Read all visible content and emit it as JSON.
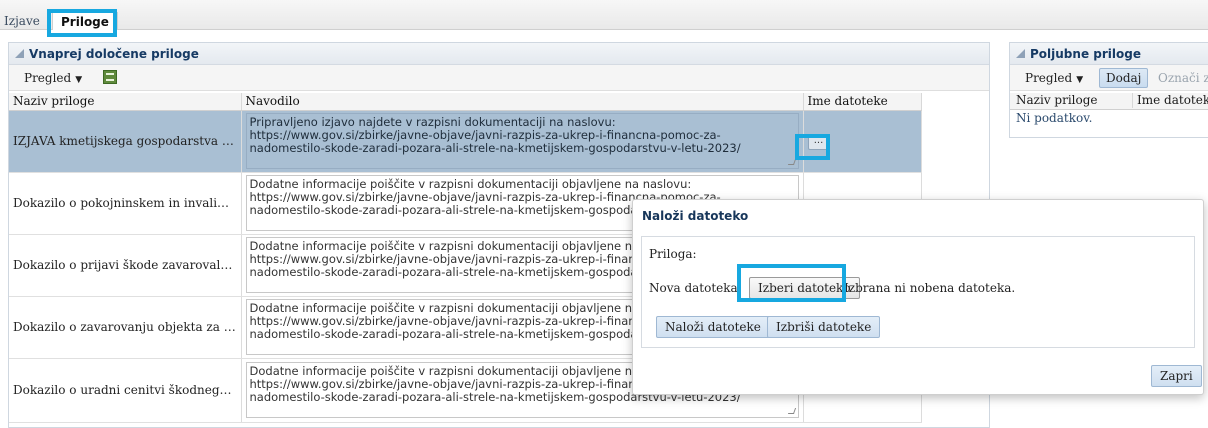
{
  "tabs": {
    "inactive_label": "Izjave",
    "active_label": "Priloge"
  },
  "left_panel": {
    "title": "Vnaprej določene priloge",
    "toolbar": {
      "view_label": "Pregled"
    },
    "columns": [
      "Naziv priloge",
      "Navodilo",
      "Ime datoteke"
    ],
    "rows": [
      {
        "name": "IZJAVA kmetijskega gospodarstva gled...",
        "instructions": [
          "Pripravljeno izjavo najdete v razpisni dokumentaciji na naslovu:",
          "https://www.gov.si/zbirke/javne-objave/javni-razpis-za-ukrep-i-financna-pomoc-za-",
          "nadomestilo-skode-zaradi-pozara-ali-strele-na-kmetijskem-gospodarstvu-v-letu-2023/"
        ],
        "file_button": "...",
        "selected": true
      },
      {
        "name": "Dokazilo o pokojninskem in invalidske...",
        "instructions": [
          "Dodatne informacije poiščite v razpisni dokumentaciji objavljene na naslovu:",
          "https://www.gov.si/zbirke/javne-objave/javni-razpis-za-ukrep-i-financna-pomoc-za-",
          "nadomestilo-skode-zaradi-pozara-ali-strele-na-kmetijskem-gospodarstvu-v-letu-2023/"
        ],
        "file_button": "",
        "selected": false
      },
      {
        "name": "Dokazilo o prijavi škode zavarovalnici",
        "instructions": [
          "Dodatne informacije poiščite v razpisni dokumentaciji objavljene na naslovu:",
          "https://www.gov.si/zbirke/javne-objave/javni-razpis-za-ukrep-i-financna-pomoc-za-",
          "nadomestilo-skode-zaradi-pozara-ali-strele-na-kmetijskem-gospodarstvu-v-letu-2023/"
        ],
        "file_button": "",
        "selected": false
      },
      {
        "name": "Dokazilo o zavarovanju objekta za prim...",
        "instructions": [
          "Dodatne informacije poiščite v razpisni dokumentaciji objavljene na naslovu:",
          "https://www.gov.si/zbirke/javne-objave/javni-razpis-za-ukrep-i-financna-pomoc-za-",
          "nadomestilo-skode-zaradi-pozara-ali-strele-na-kmetijskem-gospodarstvu-v-letu-2023/"
        ],
        "file_button": "",
        "selected": false
      },
      {
        "name": "Dokazilo o uradni cenitvi škodnega dog...",
        "instructions": [
          "Dodatne informacije poiščite v razpisni dokumentaciji objavljene na naslovu:",
          "https://www.gov.si/zbirke/javne-objave/javni-razpis-za-ukrep-i-financna-pomoc-za-",
          "nadomestilo-skode-zaradi-pozara-ali-strele-na-kmetijskem-gospodarstvu-v-letu-2023/"
        ],
        "file_button": "...",
        "selected": false
      }
    ]
  },
  "right_panel": {
    "title": "Poljubne priloge",
    "toolbar": {
      "view_label": "Pregled",
      "add_label": "Dodaj",
      "mark_label": "Označi z"
    },
    "columns": [
      "Naziv priloge",
      "Ime datoteke"
    ],
    "empty_text": "Ni podatkov."
  },
  "modal": {
    "title": "Naloži datoteko",
    "attachment_label": "Priloga:",
    "new_file_label": "Nova datoteka:",
    "choose_file_button": "Izberi datoteko",
    "no_file_text": "Izbrana ni nobena datoteka.",
    "upload_button": "Naloži datoteke",
    "delete_button": "Izbriši datoteke",
    "close_button": "Zapri"
  },
  "colors": {
    "highlight": "#17a8e0",
    "selected_row": "#a9bfd3",
    "panel_title": "#163a64"
  }
}
